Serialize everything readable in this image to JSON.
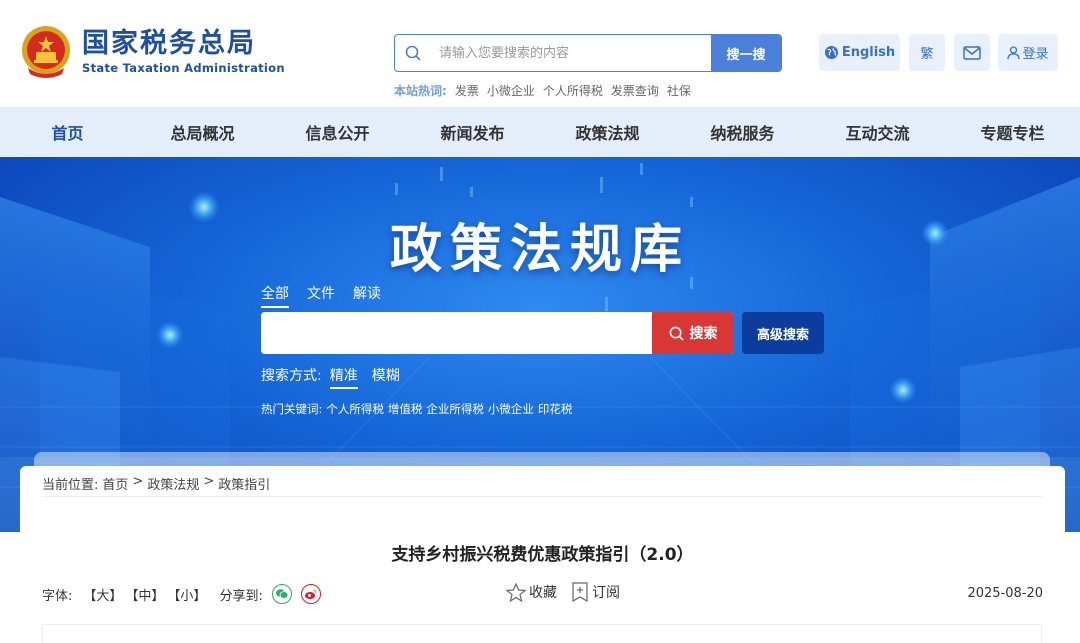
{
  "header": {
    "logo_cn": "国家税务总局",
    "logo_en": "State Taxation Administration",
    "search_placeholder": "请输入您要搜索的内容",
    "search_button": "搜一搜",
    "hotwords_label": "本站热词:",
    "hotwords": [
      "发票",
      "小微企业",
      "个人所得税",
      "发票查询",
      "社保"
    ],
    "english": "English",
    "traditional": "繁",
    "login": "登录"
  },
  "nav": {
    "items": [
      "首页",
      "总局概况",
      "信息公开",
      "新闻发布",
      "政策法规",
      "纳税服务",
      "互动交流",
      "专题专栏"
    ]
  },
  "banner": {
    "title": "政策法规库",
    "tabs": [
      "全部",
      "文件",
      "解读"
    ],
    "search_button": "搜索",
    "advanced": "高级搜索",
    "mode_label": "搜索方式:",
    "modes": [
      "精准",
      "模糊"
    ],
    "hot_label": "热门关键词:",
    "hot_keywords": [
      "个人所得税",
      "增值税",
      "企业所得税",
      "小微企业",
      "印花税"
    ]
  },
  "content": {
    "breadcrumb_label": "当前位置:",
    "breadcrumb": [
      "首页",
      "政策法规",
      "政策指引"
    ],
    "separator": ">",
    "title": "支持乡村振兴税费优惠政策指引（2.0）",
    "font_label": "字体:",
    "font_sizes": [
      "【大】",
      "【中】",
      "【小】"
    ],
    "share_label": "分享到:",
    "favorite": "收藏",
    "subscribe": "订阅",
    "date": "2025-08-20"
  },
  "colors": {
    "brand_blue": "#1d4fa5",
    "accent_blue": "#4a80d9",
    "search_red": "#d93636",
    "wechat_green": "#2aae67",
    "weibo_red": "#e6162d"
  }
}
